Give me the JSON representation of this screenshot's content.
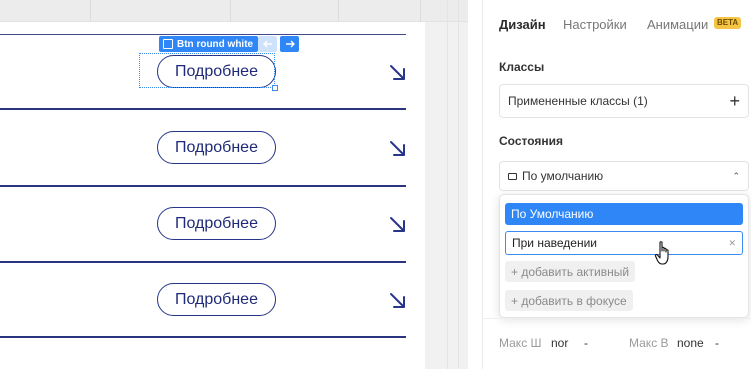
{
  "selection": {
    "tag_label": "Btn round white"
  },
  "canvas": {
    "rows": [
      {
        "button_label": "Подробнее"
      },
      {
        "button_label": "Подробнее"
      },
      {
        "button_label": "Подробнее"
      },
      {
        "button_label": "Подробнее"
      }
    ]
  },
  "panel": {
    "tabs": [
      {
        "label": "Дизайн",
        "active": true
      },
      {
        "label": "Настройки",
        "active": false
      },
      {
        "label": "Анимации",
        "active": false
      }
    ],
    "beta_badge": "BETA",
    "classes": {
      "title": "Классы",
      "applied": "Примененные классы (1)",
      "add_icon": "+"
    },
    "states": {
      "title": "Состояния",
      "selected": "По умолчанию",
      "options": {
        "default": "По Умолчанию",
        "hover_input_value": "При наведении",
        "add_active": "+ добавить активный",
        "add_focus": "+ добавить в фокусе"
      }
    },
    "size_fields": {
      "max_w_label": "Макс Ш",
      "max_w_value": "nor",
      "max_w_dash": "-",
      "max_h_label": "Макс В",
      "max_h_value": "none",
      "max_h_dash": "-"
    }
  },
  "colors": {
    "accent": "#2f86f6",
    "button_border": "#27358a",
    "badge": "#f6c445"
  }
}
